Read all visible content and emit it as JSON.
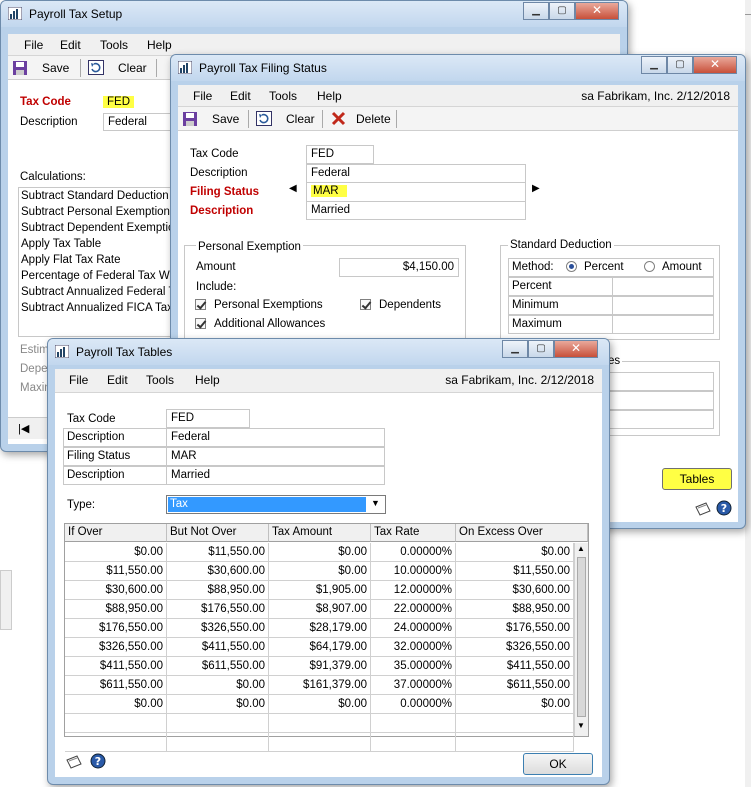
{
  "company": "sa  Fabrikam, Inc.  2/12/2018",
  "menu": [
    "File",
    "Edit",
    "Tools",
    "Help"
  ],
  "setup": {
    "title": "Payroll Tax Setup",
    "save": "Save",
    "clear": "Clear",
    "tax_code_label": "Tax Code",
    "tax_code": "FED",
    "description_label": "Description",
    "description": "Federal",
    "calculations_label": "Calculations:",
    "calculations": [
      "Subtract Standard Deduction",
      "Subtract Personal Exemption",
      "Subtract Dependent Exemption",
      "Apply Tax Table",
      "Apply Flat Tax Rate",
      "Percentage of Federal Tax With",
      "Subtract Annualized Federal Ta",
      "Subtract Annualized FICA Tax V"
    ],
    "partial_labels": [
      "Estim",
      "Depe",
      "Maxin"
    ]
  },
  "filing": {
    "title": "Payroll Tax Filing Status",
    "save": "Save",
    "clear": "Clear",
    "delete": "Delete",
    "tax_code_label": "Tax Code",
    "tax_code": "FED",
    "description_label": "Description",
    "description": "Federal",
    "filing_status_label": "Filing Status",
    "filing_status": "MAR",
    "desc2_label": "Description",
    "desc2": "Married",
    "personal_exemption": "Personal Exemption",
    "amount_label": "Amount",
    "amount": "$4,150.00",
    "include_label": "Include:",
    "personal_exemptions": "Personal Exemptions",
    "dependents": "Dependents",
    "additional_allowances": "Additional Allowances",
    "standard_deduction": "Standard Deduction",
    "method_label": "Method:",
    "percent_opt": "Percent",
    "amount_opt": "Amount",
    "percent_label": "Percent",
    "minimum_label": "Minimum",
    "maximum_label": "Maximum",
    "partial_es": "es",
    "tables_button": "Tables"
  },
  "tables": {
    "title": "Payroll Tax Tables",
    "tax_code_label": "Tax Code",
    "tax_code": "FED",
    "description_label": "Description",
    "description": "Federal",
    "filing_status_label": "Filing Status",
    "filing_status": "MAR",
    "desc2_label": "Description",
    "desc2": "Married",
    "type_label": "Type:",
    "type_value": "Tax",
    "columns": [
      "If Over",
      "But Not Over",
      "Tax Amount",
      "Tax Rate",
      "On Excess Over"
    ],
    "rows": [
      [
        "$0.00",
        "$11,550.00",
        "$0.00",
        "0.00000%",
        "$0.00"
      ],
      [
        "$11,550.00",
        "$30,600.00",
        "$0.00",
        "10.00000%",
        "$11,550.00"
      ],
      [
        "$30,600.00",
        "$88,950.00",
        "$1,905.00",
        "12.00000%",
        "$30,600.00"
      ],
      [
        "$88,950.00",
        "$176,550.00",
        "$8,907.00",
        "22.00000%",
        "$88,950.00"
      ],
      [
        "$176,550.00",
        "$326,550.00",
        "$28,179.00",
        "24.00000%",
        "$176,550.00"
      ],
      [
        "$326,550.00",
        "$411,550.00",
        "$64,179.00",
        "32.00000%",
        "$326,550.00"
      ],
      [
        "$411,550.00",
        "$611,550.00",
        "$91,379.00",
        "35.00000%",
        "$411,550.00"
      ],
      [
        "$611,550.00",
        "$0.00",
        "$161,379.00",
        "37.00000%",
        "$611,550.00"
      ],
      [
        "$0.00",
        "$0.00",
        "$0.00",
        "0.00000%",
        "$0.00"
      ]
    ],
    "ok": "OK"
  },
  "colors": {
    "required": "#c00000",
    "highlight": "#ffff44",
    "selection": "#3399ff",
    "titlebar": "#c2d7ee"
  }
}
